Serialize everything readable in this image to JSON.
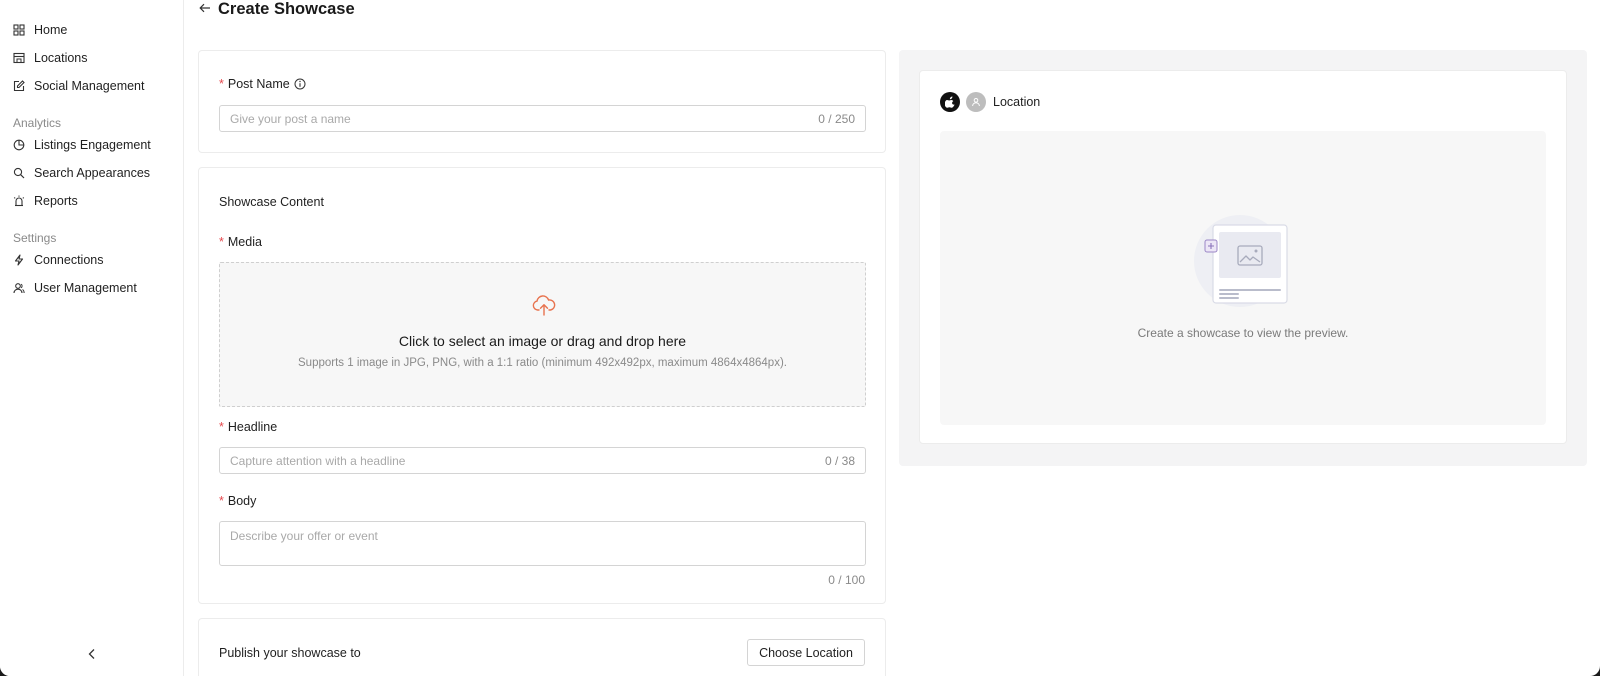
{
  "sidebar": {
    "items_top": [
      {
        "label": "Home",
        "icon": "grid-icon"
      },
      {
        "label": "Locations",
        "icon": "store-icon"
      },
      {
        "label": "Social Management",
        "icon": "edit-square-icon"
      }
    ],
    "section_analytics": "Analytics",
    "items_analytics": [
      {
        "label": "Listings Engagement",
        "icon": "pie-chart-icon"
      },
      {
        "label": "Search Appearances",
        "icon": "search-icon"
      },
      {
        "label": "Reports",
        "icon": "alarm-icon"
      }
    ],
    "section_settings": "Settings",
    "items_settings": [
      {
        "label": "Connections",
        "icon": "bolt-icon"
      },
      {
        "label": "User Management",
        "icon": "users-icon"
      }
    ],
    "collapse_icon": "chevron-left-icon"
  },
  "header": {
    "title": "Create Showcase",
    "back_icon": "arrow-left-icon"
  },
  "post_name": {
    "label": "Post Name",
    "required": "*",
    "placeholder": "Give your post a name",
    "counter": "0 / 250",
    "info_icon": "info-icon"
  },
  "content": {
    "section_title": "Showcase Content",
    "media_label": "Media",
    "required": "*",
    "dropzone_title": "Click to select an image or drag and drop here",
    "dropzone_subtitle": "Supports 1 image in JPG, PNG, with a 1:1 ratio (minimum 492x492px, maximum 4864x4864px).",
    "upload_icon": "cloud-upload-icon",
    "headline_label": "Headline",
    "headline_placeholder": "Capture attention with a headline",
    "headline_counter": "0 / 38",
    "body_label": "Body",
    "body_placeholder": "Describe your offer or event",
    "body_counter": "0 / 100"
  },
  "publish": {
    "label": "Publish your showcase to",
    "button": "Choose Location"
  },
  "preview": {
    "location_label": "Location",
    "empty_message": "Create a showcase to view the preview."
  },
  "colors": {
    "accent_upload": "#e8734f",
    "required": "#e5484d",
    "preview_bg": "#f4f4f5"
  }
}
